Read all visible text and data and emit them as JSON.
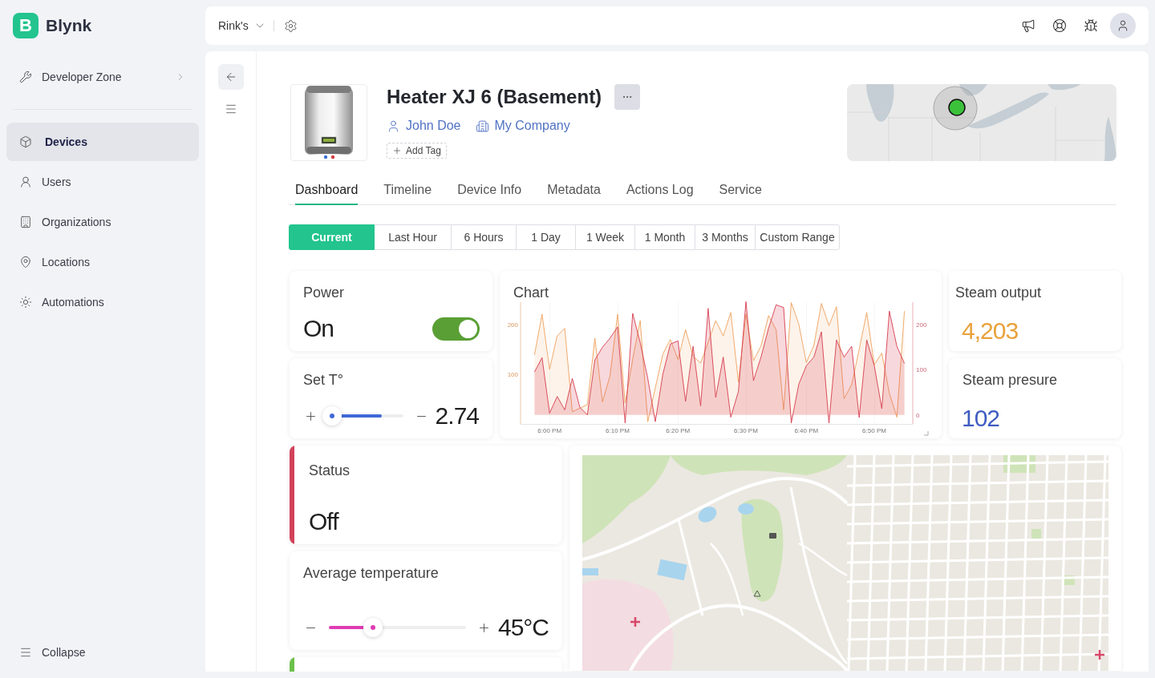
{
  "sidebar": {
    "logo": {
      "letter": "B",
      "name": "Blynk"
    },
    "developer_zone": "Developer Zone",
    "items": [
      {
        "label": "Devices",
        "selected": true
      },
      {
        "label": "Users",
        "selected": false
      },
      {
        "label": "Organizations",
        "selected": false
      },
      {
        "label": "Locations",
        "selected": false
      },
      {
        "label": "Automations",
        "selected": false
      }
    ],
    "collapse": "Collapse"
  },
  "header": {
    "organization": "Rink's"
  },
  "device": {
    "name": "Heater XJ 6 (Basement)",
    "owner": "John Doe",
    "organization": "My Company",
    "add_tag": "Add Tag"
  },
  "tabs": [
    {
      "label": "Dashboard",
      "selected": true
    },
    {
      "label": "Timeline",
      "selected": false
    },
    {
      "label": "Device Info",
      "selected": false
    },
    {
      "label": "Metadata",
      "selected": false
    },
    {
      "label": "Actions Log",
      "selected": false
    },
    {
      "label": "Service",
      "selected": false
    }
  ],
  "time_ranges": [
    {
      "label": "Current",
      "selected": true
    },
    {
      "label": "Last Hour",
      "selected": false
    },
    {
      "label": "6 Hours",
      "selected": false
    },
    {
      "label": "1 Day",
      "selected": false
    },
    {
      "label": "1 Week",
      "selected": false
    },
    {
      "label": "1 Month",
      "selected": false
    },
    {
      "label": "3 Months",
      "selected": false
    },
    {
      "label": "Custom Range",
      "selected": false
    }
  ],
  "dashboard": {
    "row_1": {
      "column_1": [
        {
          "kind": "switch",
          "title": "Power",
          "value": "On",
          "on": true
        },
        {
          "kind": "slider",
          "title": "Set T°",
          "value": "2.74",
          "level": 0.71,
          "reversed": true,
          "color": "#4068d8"
        }
      ],
      "chart": {
        "left_axis_ticks": [
          "200",
          "100"
        ],
        "chart_data": {
          "type": "area",
          "title": "Chart",
          "categories": [
            null,
            null,
            "6:00 PM",
            null,
            null,
            null,
            null,
            null,
            null,
            null,
            null,
            "6:10 PM",
            null,
            null,
            null,
            null,
            null,
            null,
            null,
            "6:20 PM",
            null,
            null,
            null,
            null,
            null,
            null,
            null,
            null,
            "6:30 PM",
            null,
            null,
            null,
            null,
            null,
            null,
            null,
            "6:40 PM",
            null,
            null,
            null,
            null,
            null,
            null,
            null,
            null,
            "6:50 PM",
            null,
            null,
            null,
            null
          ],
          "ylim": [
            -20,
            252
          ],
          "yticks": [
            0,
            100,
            200
          ],
          "series": [
            {
              "color": "#eea05c",
              "values": [
                133,
                223,
                101,
                175,
                192,
                7,
                15,
                23,
                170,
                29,
                86,
                223,
                26,
                123,
                209,
                -15,
                60,
                135,
                167,
                123,
                189,
                130,
                115,
                161,
                209,
                175,
                227,
                73,
                223,
                120,
                153,
                220,
                189,
                11,
                249,
                201,
                116,
                154,
                247,
                198,
                240,
                36,
                67,
                145,
                227,
                111,
                137,
                48,
                -5,
                230
              ]
            },
            {
              "color": "#d63d4f",
              "values": [
                95,
                127,
                4,
                41,
                11,
                81,
                17,
                0,
                122,
                150,
                170,
                195,
                -18,
                225,
                160,
                81,
                -15,
                90,
                157,
                164,
                30,
                152,
                20,
                236,
                39,
                128,
                -5,
                52,
                251,
                76,
                128,
                192,
                244,
                238,
                -18,
                68,
                109,
                128,
                184,
                -18,
                166,
                128,
                152,
                -6,
                166,
                109,
                14,
                230,
                152,
                114
              ]
            }
          ]
        }
      },
      "column_3": [
        {
          "kind": "value",
          "title": "Steam output",
          "value": "4,203",
          "color": "#e9a23b"
        },
        {
          "kind": "value",
          "title": "Steam presure",
          "value": "102",
          "color": "#3e5cc1"
        }
      ]
    },
    "row_2": {
      "column_1": [
        {
          "kind": "label",
          "title": "Status",
          "value": "Off",
          "color": "#d2415a"
        },
        {
          "kind": "slider",
          "title": "Average temperature",
          "value": "45°C",
          "level": 0.31,
          "reversed": false,
          "color": "#e03cb4"
        },
        {
          "kind": "label",
          "color": "#6cc04a"
        }
      ]
    }
  }
}
